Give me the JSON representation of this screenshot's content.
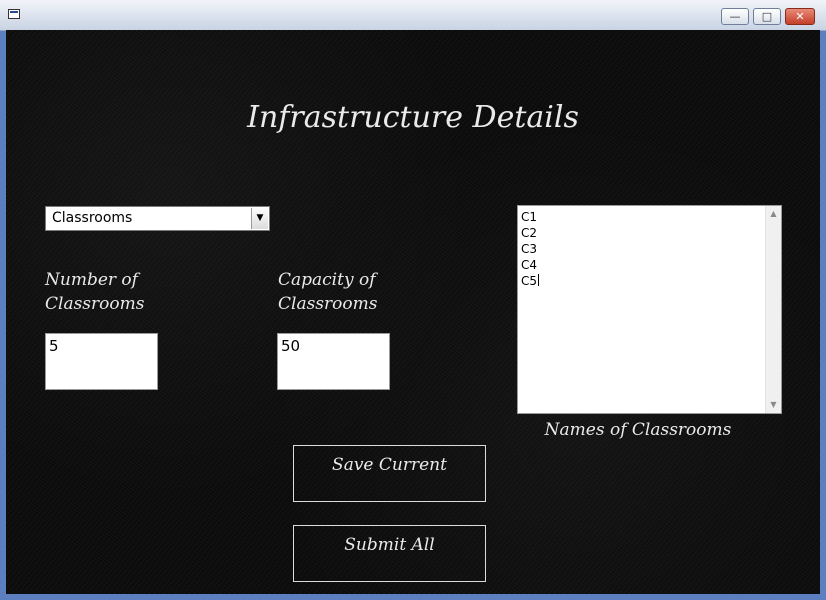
{
  "window": {
    "minimize_symbol": "—",
    "maximize_symbol": "□",
    "close_symbol": "✕"
  },
  "page": {
    "title": "Infrastructure Details"
  },
  "category_select": {
    "selected": "Classrooms",
    "arrow": "▼"
  },
  "fields": {
    "number_label": "Number of\nClassrooms",
    "number_value": "5",
    "capacity_label": "Capacity of\nClassrooms",
    "capacity_value": "50"
  },
  "classroom_list": {
    "items": [
      "C1",
      "C2",
      "C3",
      "C4",
      "C5"
    ],
    "caption": "Names of Classrooms",
    "scroll_up": "▲",
    "scroll_down": "▼"
  },
  "buttons": {
    "save_label": "Save Current",
    "submit_label": "Submit All"
  },
  "colors": {
    "background": "#0b0b0b",
    "text": "#eaeaea",
    "frame": "#5b7fbf"
  },
  "icons": {
    "app": "app-window-icon",
    "minimize": "minimize-icon",
    "maximize": "maximize-icon",
    "close": "close-icon",
    "dropdown": "chevron-down-icon"
  }
}
